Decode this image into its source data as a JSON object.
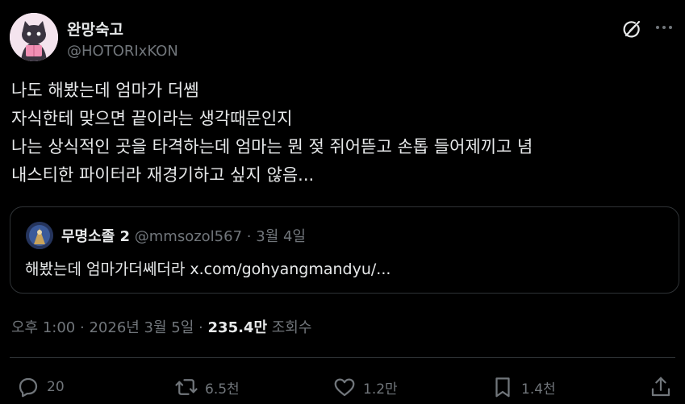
{
  "author": {
    "name": "완망숙고",
    "handle": "@HOTORIxKON"
  },
  "header_icons": {
    "grok": "grok-icon",
    "more": "more-icon"
  },
  "tweet": {
    "lines": [
      "나도 해봤는데 엄마가 더쎔",
      "자식한테 맞으면 끝이라는 생각때문인지",
      "나는 상식적인 곳을 타격하는데 엄마는 뭔 젖 쥐어뜯고 손톱 들어제끼고 념",
      "내스티한 파이터라 재경기하고 싶지 않음..."
    ]
  },
  "quote": {
    "name": "무명소졸 2",
    "handle": "@mmsozol567",
    "separator": "·",
    "date": "3월 4일",
    "text": "해봤는데 엄마가더쎄더라 x.com/gohyangmandyu/..."
  },
  "meta": {
    "time": "오후 1:00",
    "sep1": "·",
    "date": "2026년 3월 5일",
    "sep2": "·",
    "views": "235.4만",
    "views_label": "조회수"
  },
  "actions": {
    "reply": "20",
    "repost": "6.5천",
    "like": "1.2만",
    "bookmark": "1.4천"
  },
  "colors": {
    "background": "#000000",
    "text": "#e7e9ea",
    "muted": "#71767b",
    "border": "#2f3336"
  }
}
